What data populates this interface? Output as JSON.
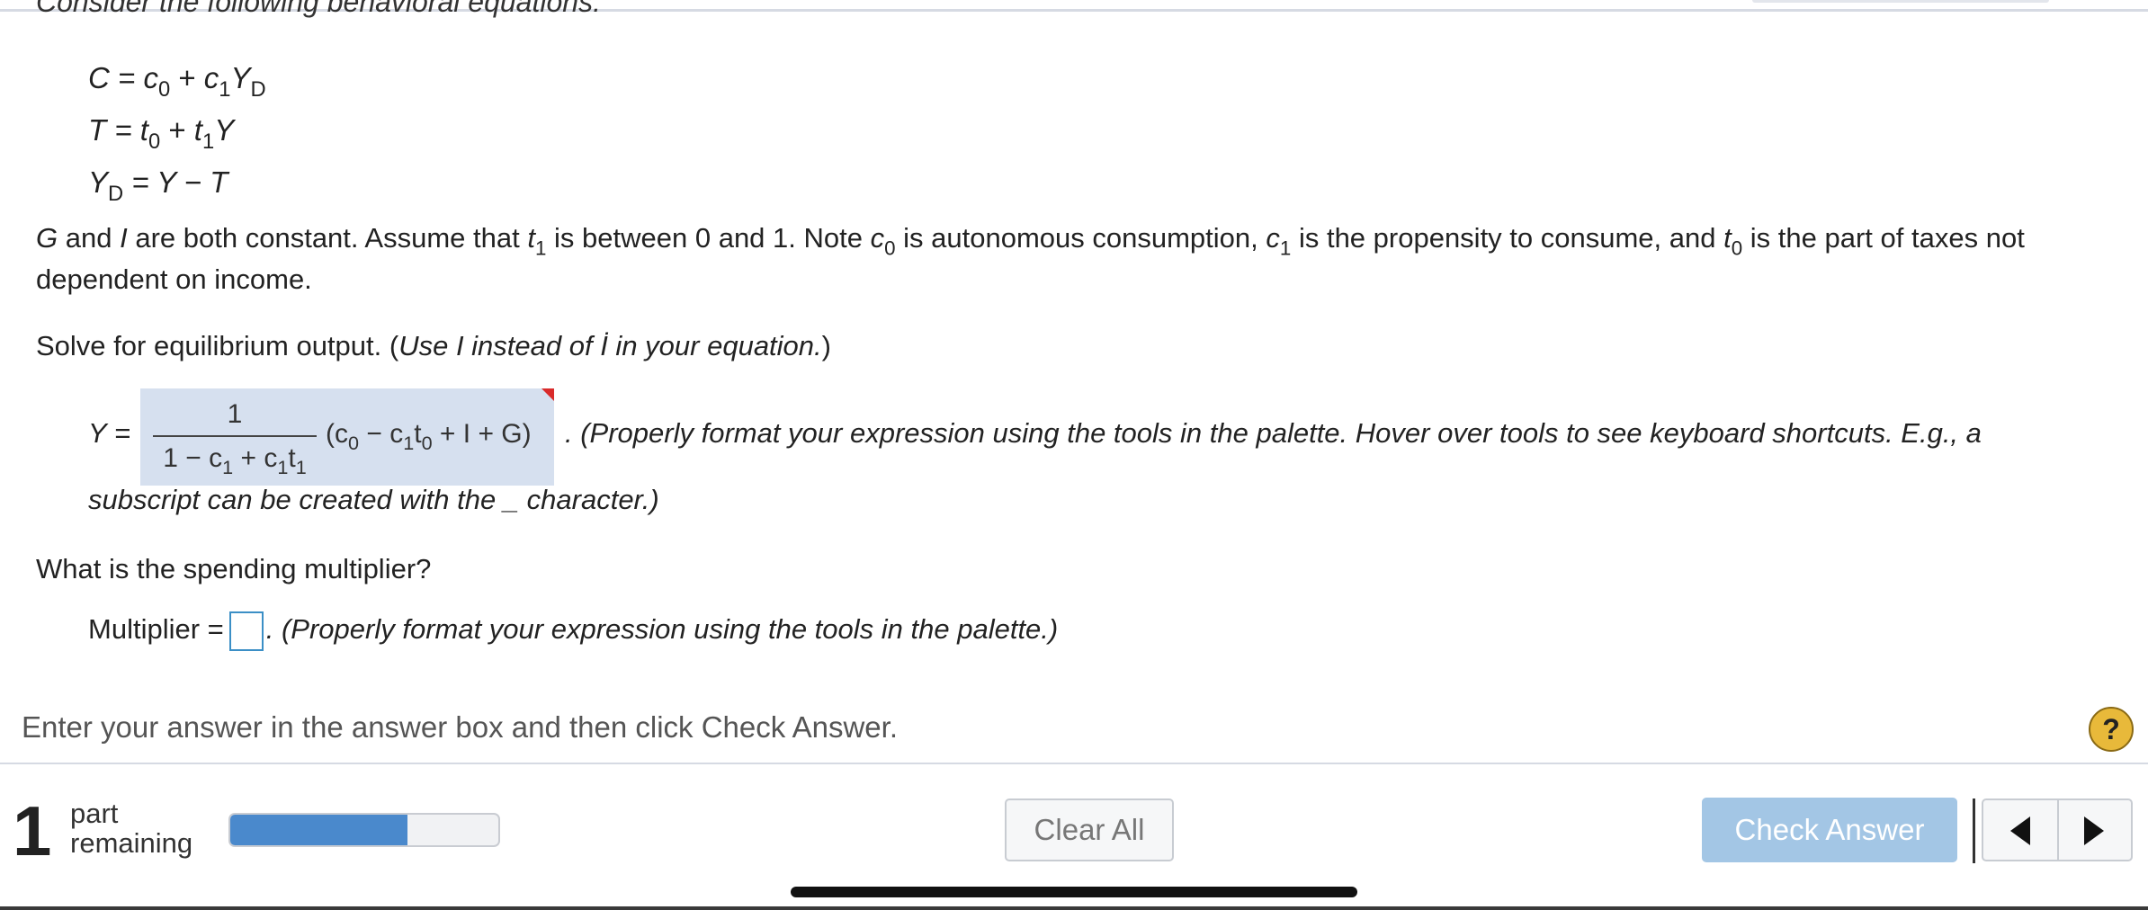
{
  "question": {
    "cut_off_line": "Consider the following behavioral equations:",
    "equations": {
      "consumption": {
        "lhs": "C",
        "rhs_a": "c",
        "rhs_a_sub": "0",
        "plus": "+",
        "rhs_b": "c",
        "rhs_b_sub": "1",
        "rhs_c": "Y",
        "rhs_c_sub": "D"
      },
      "taxes": {
        "lhs": "T",
        "rhs_a": "t",
        "rhs_a_sub": "0",
        "plus": "+",
        "rhs_b": "t",
        "rhs_b_sub": "1",
        "rhs_c": "Y"
      },
      "disposable": {
        "lhs": "Y",
        "lhs_sub": "D",
        "rhs": "Y − T"
      }
    },
    "assumption": {
      "g": "G",
      "and": "and",
      "i": "I",
      "text1": "are both constant. Assume that",
      "t": "t",
      "t_sub": "1",
      "text2": "is between 0 and 1. Note",
      "c0": "c",
      "c0_sub": "0",
      "text3": "is autonomous consumption,",
      "c1": "c",
      "c1_sub": "1",
      "text4": "is the propensity to consume, and",
      "t0": "t",
      "t0_sub": "0",
      "text5": "is the part of taxes not dependent on income."
    },
    "part1": {
      "prompt": "Solve for equilibrium output. (",
      "prompt_italic": "Use I instead of İ in your equation.",
      "prompt_close": ")",
      "lhs": "Y",
      "equals": "=",
      "answer": {
        "numerator": "1",
        "den_one": "1 − c",
        "den_one_sub": "1",
        "den_plus": " + c",
        "den_c_sub": "1",
        "den_t": "t",
        "den_t_sub": "1",
        "paren_open": "(c",
        "paren_c0_sub": "0",
        "paren_minus": " − c",
        "paren_c1_sub": "1",
        "paren_t": "t",
        "paren_t0_sub": "0",
        "paren_rest": " + I + G)"
      },
      "note_a": ". (Properly format your expression using the tools in the palette. Hover over tools to see keyboard shortcuts. E.g., a",
      "note_b": "subscript can be created with the _ character.)"
    },
    "part2": {
      "prompt": "What is the spending multiplier?",
      "label": "Multiplier =",
      "value": "",
      "note": ". (Properly format your expression using the tools in the palette.)"
    }
  },
  "instruction": "Enter your answer in the answer box and then click Check Answer.",
  "help_label": "?",
  "footer": {
    "parts_count": "1",
    "parts_word1": "part",
    "parts_word2": "remaining",
    "progress": 0.66,
    "clear_all": "Clear All",
    "check_answer": "Check Answer"
  },
  "colors": {
    "accent": "#4a89cc",
    "check_button": "#a3c6e5",
    "math_highlight": "#d6e0ef",
    "help_button": "#e8b93a",
    "flag": "#d92b2b"
  },
  "icons": {
    "help": "question-mark-icon",
    "prev": "triangle-left-icon",
    "next": "triangle-right-icon"
  }
}
